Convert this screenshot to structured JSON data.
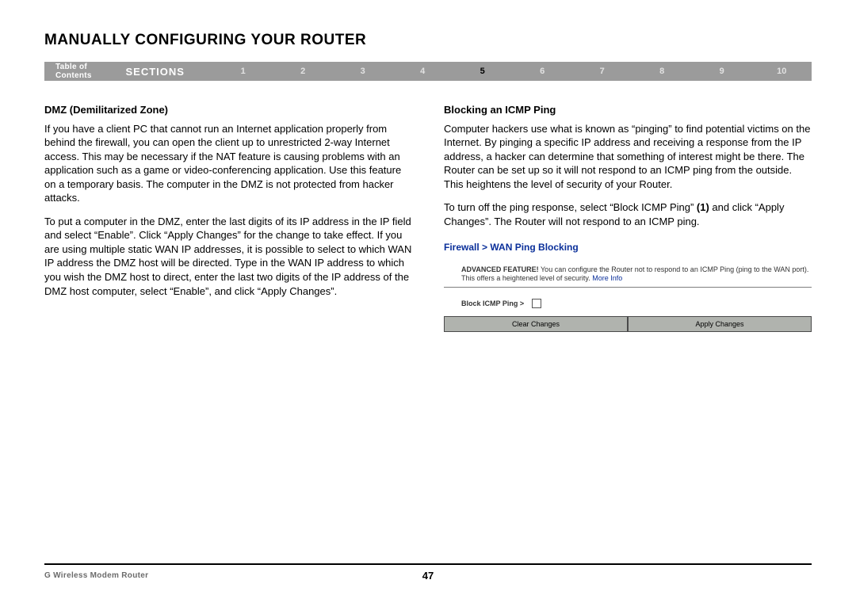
{
  "title": "MANUALLY CONFIGURING YOUR ROUTER",
  "nav": {
    "toc": "Table of Contents",
    "sections": "SECTIONS",
    "items": [
      "1",
      "2",
      "3",
      "4",
      "5",
      "6",
      "7",
      "8",
      "9",
      "10"
    ],
    "active": "5"
  },
  "left": {
    "h": "DMZ (Demilitarized Zone)",
    "p1": "If you have a client PC that cannot run an Internet application properly from behind the firewall, you can open the client up to unrestricted 2-way Internet access. This may be necessary if the NAT feature is causing problems with an application such as a game or video-conferencing application. Use this feature on a temporary basis. The computer in the DMZ is not protected from hacker attacks.",
    "p2": "To put a computer in the DMZ, enter the last digits of its IP address in the IP field and select “Enable”. Click “Apply Changes” for the change to take effect. If you are using multiple static WAN IP addresses, it is possible to select to which WAN IP address the DMZ host will be directed. Type in the WAN IP address to which you wish the DMZ host to direct, enter the last two digits of the IP address of the DMZ host computer, select “Enable”, and click “Apply Changes”."
  },
  "right": {
    "h": "Blocking an ICMP Ping",
    "p1": "Computer hackers use what is known as “pinging” to find potential victims on the Internet. By pinging a specific IP address and receiving a response from the IP address, a hacker can determine that something of interest might be there. The Router can be set up so it will not respond to an ICMP ping from the outside. This heightens the level of security of your Router.",
    "p2a": "To turn off the ping response, select “Block ICMP Ping” ",
    "p2b": "(1)",
    "p2c": " and click “Apply Changes”. The Router will not respond to an ICMP ping."
  },
  "ss": {
    "bc1": "Firewall",
    "bc2": "WAN Ping Blocking",
    "adv_label": "ADVANCED FEATURE!",
    "adv_text": " You can configure the Router not to respond to an ICMP Ping (ping to the WAN port). This offers a heightened level of security. ",
    "adv_more": "More Info",
    "block_label": "Block ICMP Ping >",
    "btn_clear": "Clear Changes",
    "btn_apply": "Apply Changes"
  },
  "footer": {
    "left": "G Wireless Modem Router",
    "page": "47"
  }
}
